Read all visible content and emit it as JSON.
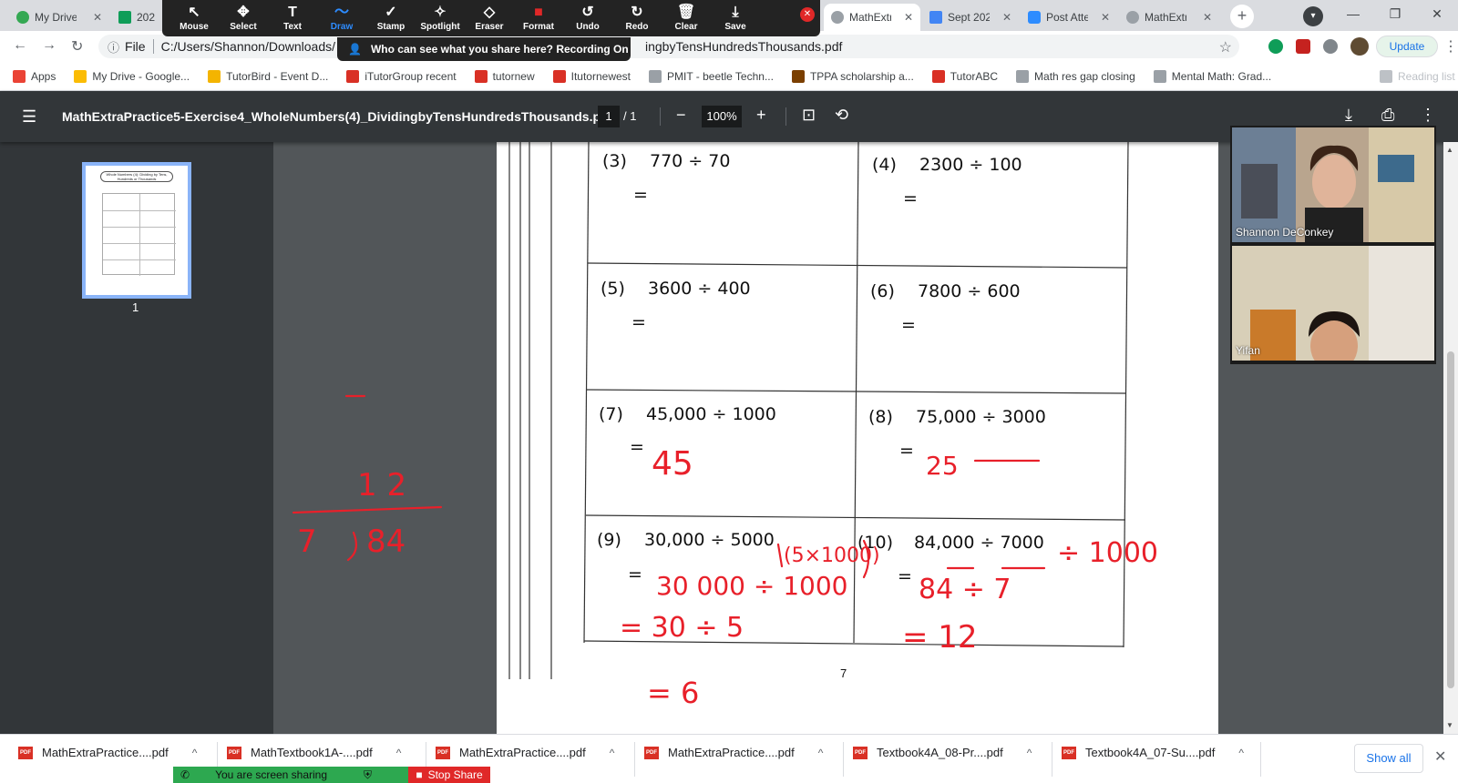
{
  "tabs": [
    {
      "label": "My Drive",
      "color": "#34a853",
      "active": false
    },
    {
      "label": "2021",
      "color": "#0f9d58",
      "active": false
    },
    {
      "label": "MathExtr",
      "color": "#5f6368",
      "active": true
    },
    {
      "label": "Sept 202",
      "color": "#4285f4",
      "active": false
    },
    {
      "label": "Post Atte",
      "color": "#2d8cff",
      "active": false
    },
    {
      "label": "MathExtr",
      "color": "#5f6368",
      "active": false
    }
  ],
  "zoom_toolbar": {
    "tools": [
      {
        "label": "Mouse",
        "icon": "cursor-icon",
        "glyph": "↖"
      },
      {
        "label": "Select",
        "icon": "move-icon",
        "glyph": "✥"
      },
      {
        "label": "Text",
        "icon": "text-icon",
        "glyph": "T"
      },
      {
        "label": "Draw",
        "icon": "draw-icon",
        "glyph": "〜"
      },
      {
        "label": "Stamp",
        "icon": "stamp-icon",
        "glyph": "✓"
      },
      {
        "label": "Spotlight",
        "icon": "spotlight-icon",
        "glyph": "✧"
      },
      {
        "label": "Eraser",
        "icon": "eraser-icon",
        "glyph": "◇"
      },
      {
        "label": "Format",
        "icon": "format-icon",
        "glyph": "■"
      },
      {
        "label": "Undo",
        "icon": "undo-icon",
        "glyph": "↺"
      },
      {
        "label": "Redo",
        "icon": "redo-icon",
        "glyph": "↻"
      },
      {
        "label": "Clear",
        "icon": "trash-icon",
        "glyph": "🗑"
      },
      {
        "label": "Save",
        "icon": "save-icon",
        "glyph": "⤓"
      }
    ],
    "active": "Draw",
    "recording_notice": "Who can see what you share here? Recording On"
  },
  "omnibox": {
    "scheme": "File",
    "url_left": "C:/Users/Shannon/Downloads/",
    "url_right": "ingbyTensHundredsThousands.pdf"
  },
  "update_label": "Update",
  "bookmarks": [
    {
      "label": "Apps",
      "color": "#ea4335"
    },
    {
      "label": "My Drive - Google...",
      "color": "#fbbc04"
    },
    {
      "label": "TutorBird - Event D...",
      "color": "#f4b400"
    },
    {
      "label": "iTutorGroup recent",
      "color": "#d93025"
    },
    {
      "label": "tutornew",
      "color": "#d93025"
    },
    {
      "label": "Itutornewest",
      "color": "#d93025"
    },
    {
      "label": "PMIT - beetle Techn...",
      "color": "#9aa0a6"
    },
    {
      "label": "TPPA scholarship a...",
      "color": "#7b3f00"
    },
    {
      "label": "TutorABC",
      "color": "#d93025"
    },
    {
      "label": "Math res gap closing",
      "color": "#9aa0a6"
    },
    {
      "label": "Mental Math: Grad...",
      "color": "#9aa0a6"
    },
    {
      "label": "Reading list",
      "color": "#bdc1c6"
    }
  ],
  "pdf": {
    "title": "MathExtraPractice5-Exercise4_WholeNumbers(4)_DividingbyTensHundredsThousands.pdf",
    "page_current": "1",
    "page_total": "/ 1",
    "zoom": "100%",
    "thumb_title": "Whole Numbers (4): Dividing by Tens, Hundreds or Thousands",
    "thumb_page": "1",
    "problems": [
      {
        "num": "(3)",
        "expr": "770 ÷ 70",
        "eq": "="
      },
      {
        "num": "(4)",
        "expr": "2300 ÷ 100",
        "eq": "="
      },
      {
        "num": "(5)",
        "expr": "3600 ÷ 400",
        "eq": "="
      },
      {
        "num": "(6)",
        "expr": "7800 ÷ 600",
        "eq": "="
      },
      {
        "num": "(7)",
        "expr": "45,000 ÷ 1000",
        "eq": "="
      },
      {
        "num": "(8)",
        "expr": "75,000 ÷ 3000",
        "eq": "="
      },
      {
        "num": "(9)",
        "expr": "30,000 ÷ 5000",
        "eq": "="
      },
      {
        "num": "(10)",
        "expr": "84,000 ÷ 7000",
        "eq": "="
      }
    ],
    "page_number": "7"
  },
  "annotations": {
    "color": "#e8202a",
    "a7": "45",
    "a8": "25",
    "a9_hint": "(5×1000)",
    "a9_line1": "30 000 ÷ 1000",
    "a9_line2": "= 30 ÷ 5",
    "a9_line3": "= 6",
    "a10_div": "÷ 1000",
    "a10_line1": "84 ÷ 7",
    "a10_line2": "= 12",
    "ld_quotient": "1 2",
    "ld_divisor": "7",
    "ld_dividend": "84"
  },
  "video": {
    "participants": [
      {
        "name": "Shannon DeConkey"
      },
      {
        "name": "Yifan"
      }
    ]
  },
  "downloads": [
    "MathExtraPractice....pdf",
    "MathTextbook1A-....pdf",
    "MathExtraPractice....pdf",
    "MathExtraPractice....pdf",
    "Textbook4A_08-Pr....pdf",
    "Textbook4A_07-Su....pdf"
  ],
  "show_all": "Show all",
  "sharing": {
    "status": "You are screen sharing",
    "stop": "Stop Share"
  }
}
